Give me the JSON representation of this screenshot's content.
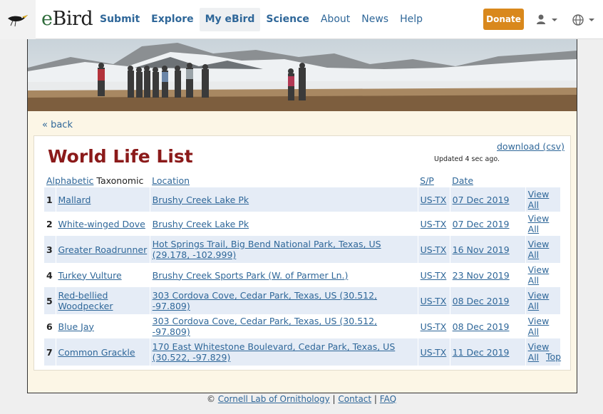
{
  "header": {
    "logo": "eBird",
    "nav": [
      {
        "label": "Submit",
        "bold": true
      },
      {
        "label": "Explore",
        "bold": true
      },
      {
        "label": "My eBird",
        "bold": true,
        "active": true
      },
      {
        "label": "Science",
        "bold": true
      },
      {
        "label": "About",
        "bold": false
      },
      {
        "label": "News",
        "bold": false
      },
      {
        "label": "Help",
        "bold": false
      }
    ],
    "donate": "Donate",
    "icons": {
      "user": "user-icon",
      "globe": "globe-icon"
    }
  },
  "page": {
    "back": "« back",
    "download": "download (csv)",
    "title": "World Life List",
    "updated": "Updated 4 sec ago.",
    "top": "Top"
  },
  "table": {
    "sort_alpha": "Alphabetic",
    "sort_tax": "Taxonomic",
    "col_location": "Location",
    "col_sp": "S/P",
    "col_date": "Date",
    "rows": [
      {
        "n": "1",
        "species": "Mallard",
        "location": "Brushy Creek Lake Pk",
        "sp": "US-TX",
        "date": "07 Dec 2019",
        "view": "View All"
      },
      {
        "n": "2",
        "species": "White-winged Dove",
        "location": "Brushy Creek Lake Pk",
        "sp": "US-TX",
        "date": "07 Dec 2019",
        "view": "View All"
      },
      {
        "n": "3",
        "species": "Greater Roadrunner",
        "location": "Hot Springs Trail, Big Bend National Park, Texas, US (29.178, -102.999)",
        "sp": "US-TX",
        "date": "16 Nov 2019",
        "view": "View All"
      },
      {
        "n": "4",
        "species": "Turkey Vulture",
        "location": "Brushy Creek Sports Park (W. of Parmer Ln.)",
        "sp": "US-TX",
        "date": "23 Nov 2019",
        "view": "View All"
      },
      {
        "n": "5",
        "species": "Red-bellied Woodpecker",
        "location": "303 Cordova Cove, Cedar Park, Texas, US (30.512, -97.809)",
        "sp": "US-TX",
        "date": "08 Dec 2019",
        "view": "View All"
      },
      {
        "n": "6",
        "species": "Blue Jay",
        "location": "303 Cordova Cove, Cedar Park, Texas, US (30.512, -97.809)",
        "sp": "US-TX",
        "date": "08 Dec 2019",
        "view": "View All"
      },
      {
        "n": "7",
        "species": "Common Grackle",
        "location": "170 East Whitestone Boulevard, Cedar Park, Texas, US (30.522, -97.829)",
        "sp": "US-TX",
        "date": "11 Dec 2019",
        "view": "View All"
      }
    ]
  },
  "footer": {
    "copyright": "©",
    "lab": "Cornell Lab of Ornithology",
    "sep1": "|",
    "contact": "Contact",
    "sep2": "|",
    "faq": "FAQ"
  },
  "colors": {
    "title": "#8b1a1a",
    "link": "#2f6799",
    "donate": "#d9881c",
    "row_alt": "#e5ecf6"
  }
}
